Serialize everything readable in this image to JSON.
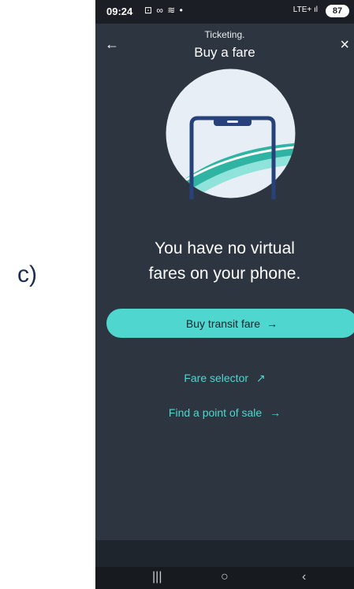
{
  "caption": "c)",
  "status_bar": {
    "time": "09:24",
    "status_icons": "⊡ ∞ ≋ •",
    "signal": "LTE+ ıl",
    "battery": "87"
  },
  "header": {
    "kicker": "Ticketing.",
    "title": "Buy a fare",
    "back_icon": "←",
    "close_icon": "×"
  },
  "message": {
    "line1": "You have no virtual",
    "line2": "fares on your phone."
  },
  "primary_button": {
    "label": "Buy transit fare",
    "arrow": "→"
  },
  "links": {
    "fare_selector": "Fare selector",
    "fare_selector_icon": "↗",
    "point_of_sale": "Find a point of sale",
    "point_of_sale_arrow": "→"
  },
  "system_nav": {
    "recents": "|||",
    "home": "○",
    "back": "‹"
  },
  "colors": {
    "background": "#2d3640",
    "accent": "#4fd6cf",
    "illustration_circle": "#e7eef6",
    "phone_outline": "#27427a"
  }
}
